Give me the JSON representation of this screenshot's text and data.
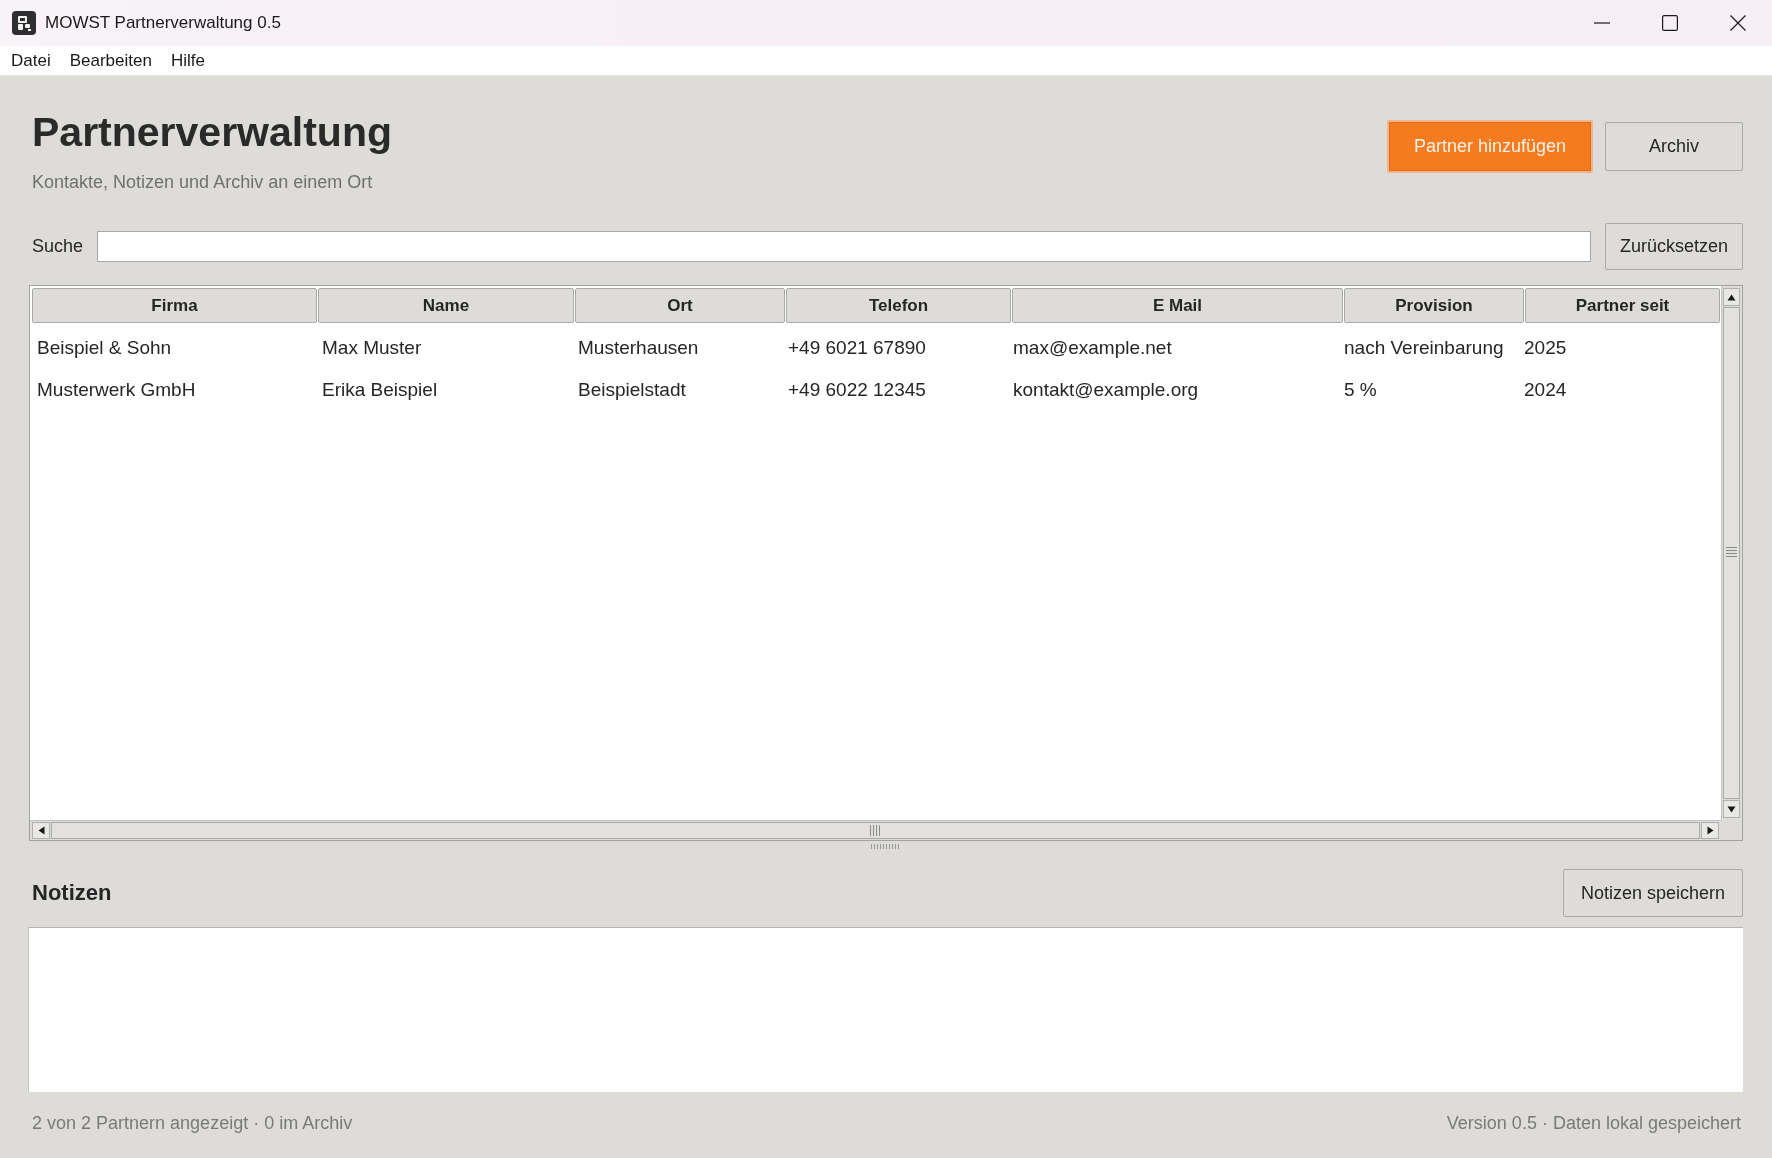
{
  "window": {
    "title": "MOWST Partnerverwaltung 0.5"
  },
  "menu": [
    "Datei",
    "Bearbeiten",
    "Hilfe"
  ],
  "header": {
    "title": "Partnerverwaltung",
    "subtitle": "Kontakte, Notizen und Archiv an einem Ort"
  },
  "actions": [
    {
      "label": "Partner hinzufügen",
      "kind": "primary"
    },
    {
      "label": "Archiv",
      "kind": "secondary"
    }
  ],
  "search": {
    "label": "Suche",
    "reset_button": "Zurücksetzen"
  },
  "table": {
    "columns": [
      "Firma",
      "Name",
      "Ort",
      "Telefon",
      "E Mail",
      "Provision",
      "Partner seit"
    ],
    "rows": [
      [
        "Beispiel & Sohn",
        "Max Muster",
        "Musterhausen",
        "+49 6021 67890",
        "max@example.net",
        "nach Vereinbarung",
        "2025"
      ],
      [
        "Musterwerk GmbH",
        "Erika Beispiel",
        "Beispielstadt",
        "+49 6022 12345",
        "kontakt@example.org",
        "5 %",
        "2024"
      ]
    ]
  },
  "notes": {
    "title": "Notizen",
    "save_button": "Notizen speichern"
  },
  "status_bar": {
    "left": "2 von 2 Partnern angezeigt · 0 im Archiv",
    "right": "Version 0.5 · Daten lokal gespeichert"
  }
}
